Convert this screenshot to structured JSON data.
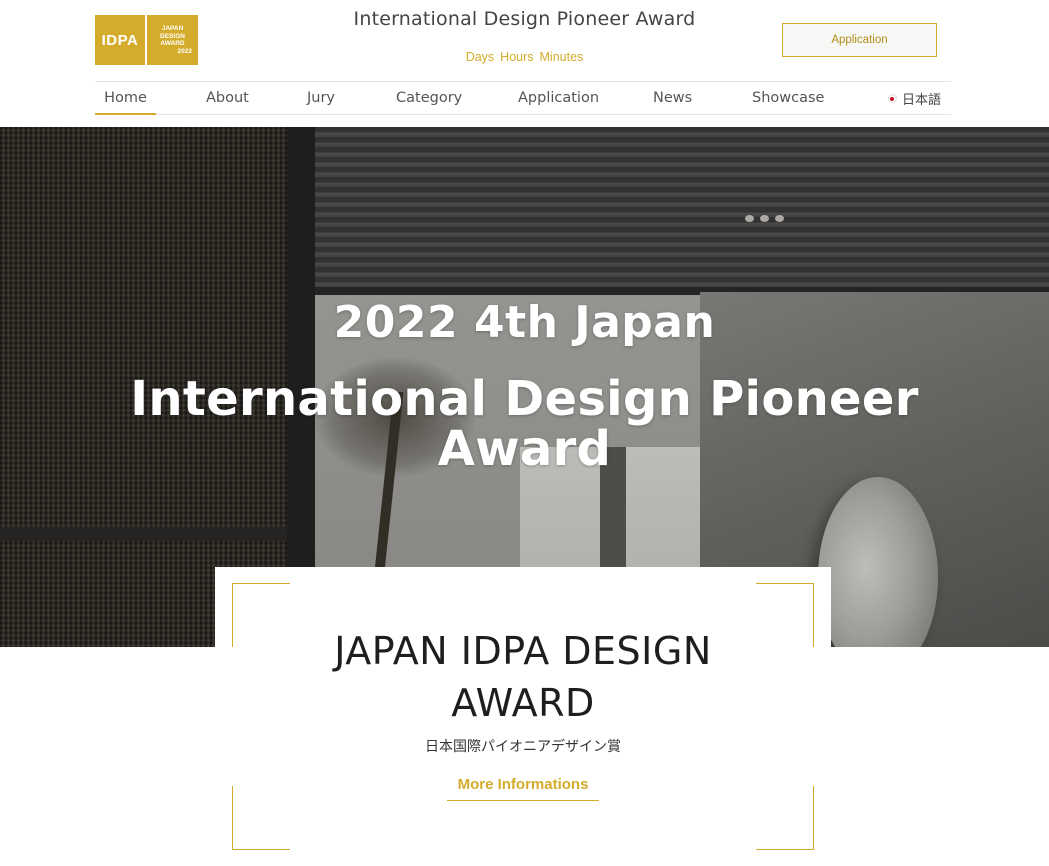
{
  "logo": {
    "main": "IDPA",
    "sub_lines": [
      "JAPAN",
      "DESIGN",
      "AWARD"
    ],
    "year": "2022",
    "brand_color": "#d4ac2b"
  },
  "header": {
    "site_title": "International Design Pioneer Award",
    "countdown": {
      "days": "Days",
      "hours": "Hours",
      "minutes": "Minutes"
    },
    "apply_button": "Application"
  },
  "nav": {
    "items": [
      {
        "label": "Home",
        "active": true
      },
      {
        "label": "About"
      },
      {
        "label": "Jury"
      },
      {
        "label": "Category"
      },
      {
        "label": "Application"
      },
      {
        "label": "News"
      },
      {
        "label": "Showcase"
      }
    ],
    "language": {
      "label": "日本語",
      "icon": "japan-flag-icon"
    }
  },
  "hero": {
    "line1": "2022 4th Japan",
    "line2": "International Design Pioneer",
    "line3": "Award"
  },
  "card": {
    "title_line1": "JAPAN IDPA DESIGN",
    "title_line2": "AWARD",
    "subtitle": "日本国際パイオニアデザイン賞",
    "more_link": "More Informations"
  }
}
